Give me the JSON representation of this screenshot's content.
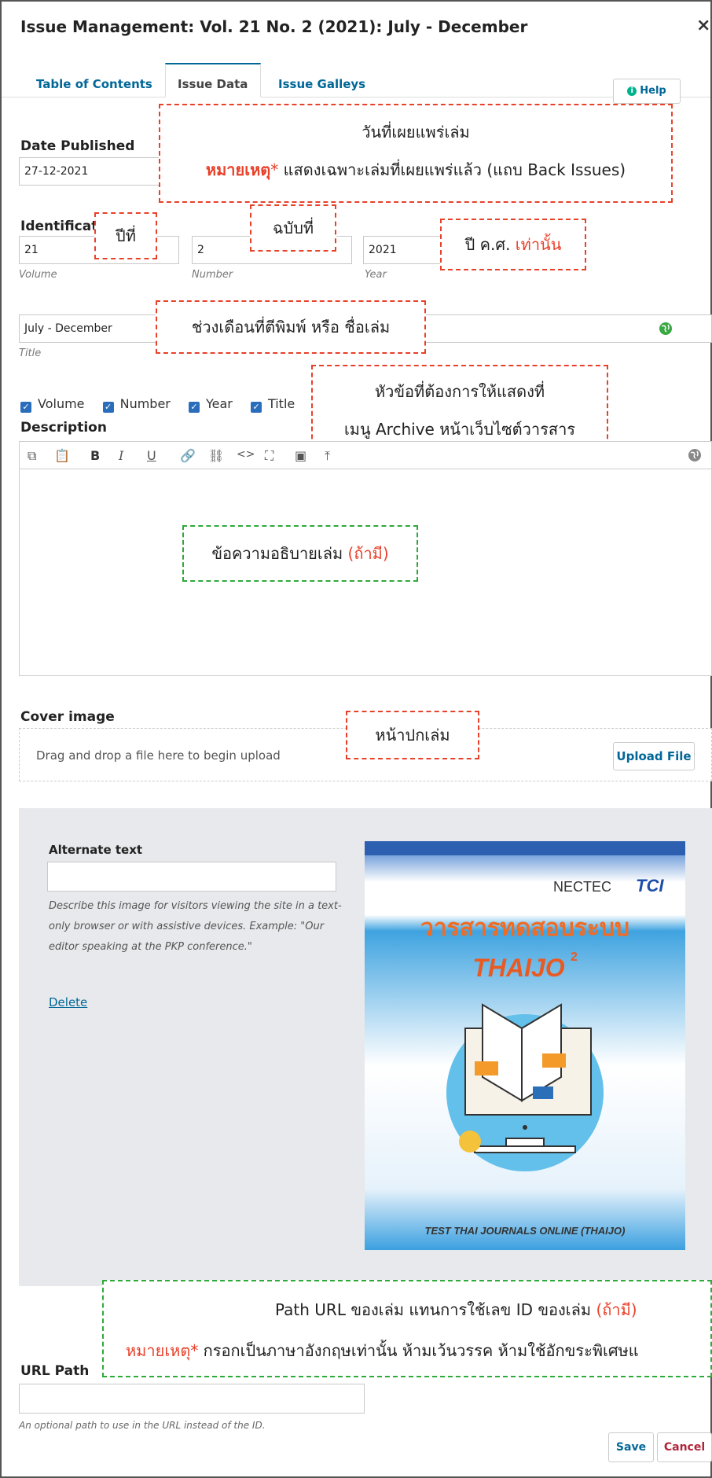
{
  "header": {
    "title": "Issue Management: Vol. 21 No. 2 (2021): July - December",
    "close": "×"
  },
  "tabs": [
    {
      "label": "Table of Contents"
    },
    {
      "label": "Issue Data"
    },
    {
      "label": "Issue Galleys"
    }
  ],
  "help": {
    "label": "Help",
    "icon": "i"
  },
  "date_published": {
    "label": "Date Published",
    "value": "27-12-2021"
  },
  "identification": {
    "label": "Identificat",
    "volume": {
      "value": "21",
      "sublabel": "Volume"
    },
    "number": {
      "value": "2",
      "sublabel": "Number"
    },
    "year": {
      "value": "2021",
      "sublabel": "Year"
    },
    "title": {
      "value": "July - December",
      "sublabel": "Title"
    }
  },
  "show_checkboxes": [
    {
      "label": "Volume"
    },
    {
      "label": "Number"
    },
    {
      "label": "Year"
    },
    {
      "label": "Title"
    }
  ],
  "description": {
    "label": "Description"
  },
  "editor_toolbar": [
    "copy-icon",
    "paste-icon",
    "bold-icon",
    "italic-icon",
    "underline-icon",
    "link-icon",
    "unlink-icon",
    "code-icon",
    "fullscreen-icon",
    "image-icon",
    "upload-icon"
  ],
  "toolbar_glyphs": {
    "bold": "B",
    "italic": "I",
    "underline": "U",
    "code": "<>"
  },
  "cover": {
    "label": "Cover image",
    "drop_text": "Drag and drop a file here to begin upload",
    "upload_button": "Upload File",
    "alt_label": "Alternate text",
    "alt_help": "Describe this image for visitors viewing the site in a text-only browser or with assistive devices. Example: \"Our editor speaking at the PKP conference.\"",
    "delete_link": "Delete",
    "image": {
      "logo1": "NECTEC",
      "logo2": "TCI",
      "title_line": "วารสารทดสอบระบบ",
      "subtitle": "THAIJO",
      "subtitle_sup": "2",
      "footer": "TEST THAI JOURNALS ONLINE (THAIJO)"
    }
  },
  "url_path": {
    "label": "URL Path",
    "help": "An optional path to use in the URL instead of the ID."
  },
  "buttons": {
    "save": "Save",
    "cancel": "Cancel"
  },
  "annotations": {
    "date_title": "วันที่เผยแพร่เล่ม",
    "date_note_prefix": "หมายเหตุ",
    "date_note_star": "*",
    "date_note_text": " แสดงเฉพาะเล่มที่เผยแพร่แล้ว (แถบ Back Issues)",
    "volume": "ปีที่",
    "number": "ฉบับที่",
    "year_text": "ปี ค.ศ. ",
    "year_red": "เท่านั้น",
    "title": "ช่วงเดือนที่ตีพิมพ์ หรือ ชื่อเล่ม",
    "show_line1": "หัวข้อที่ต้องการให้แสดงที่",
    "show_line2": "เมนู Archive หน้าเว็บไซต์วารสาร",
    "desc_text": "ข้อความอธิบายเล่ม ",
    "desc_red": "(ถ้ามี)",
    "cover": "หน้าปกเล่ม",
    "url_line1_text": "Path URL ของเล่ม แทนการใช้เลข ID ของเล่ม ",
    "url_line1_red": "(ถ้ามี)",
    "url_note_prefix": "หมายเหตุ*",
    "url_note_text": " กรอกเป็นภาษาอังกฤษเท่านั้น ห้ามเว้นวรรค ห้ามใช้อักขระพิเศษแ"
  }
}
